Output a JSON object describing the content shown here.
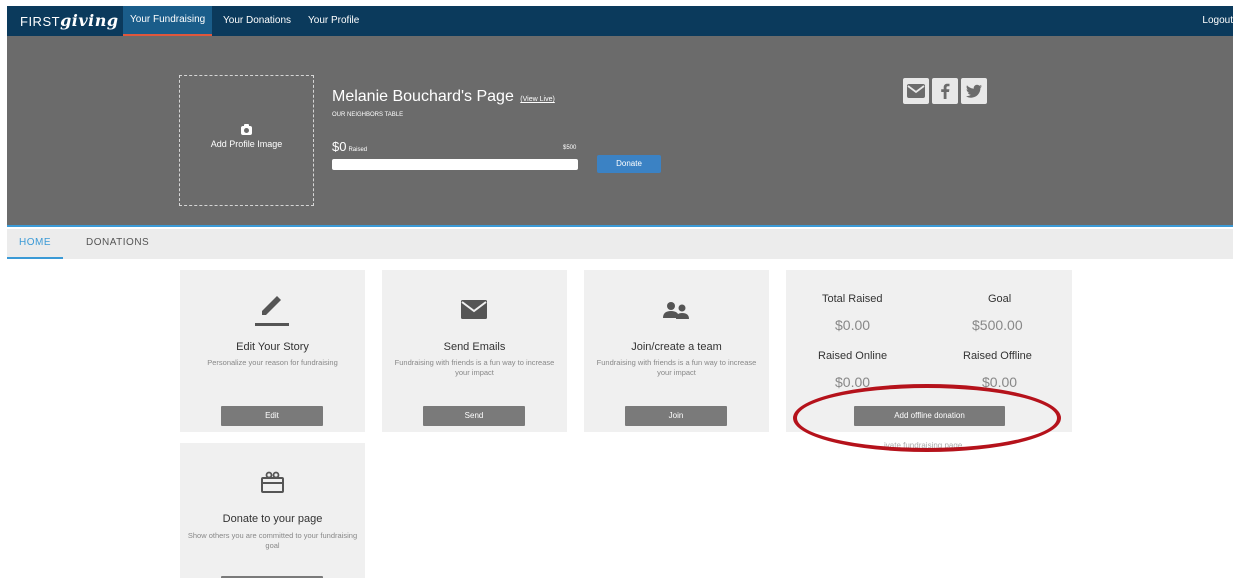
{
  "topnav": {
    "logo_prefix": "FIRST",
    "logo_suffix": "giving",
    "tabs": [
      {
        "label": "Your Fundraising",
        "active": true
      },
      {
        "label": "Your Donations",
        "active": false
      },
      {
        "label": "Your Profile",
        "active": false
      }
    ],
    "logout_label": "Logout"
  },
  "header": {
    "add_profile_image_label": "Add Profile Image",
    "page_title": "Melanie Bouchard's Page",
    "view_live_label": "(View Live)",
    "organization": "OUR NEIGHBORS TABLE",
    "raised_amount": "$0",
    "raised_label": "Raised",
    "goal_amount": "$500",
    "progress_fraction": 0,
    "donate_label": "Donate",
    "share_icons": [
      "email-icon",
      "facebook-icon",
      "twitter-icon"
    ]
  },
  "subnav": {
    "tabs": [
      {
        "label": "HOME",
        "active": true
      },
      {
        "label": "DONATIONS",
        "active": false
      }
    ]
  },
  "cards": {
    "story": {
      "icon": "pencil-icon",
      "title": "Edit Your Story",
      "description": "Personalize your reason for fundraising",
      "button": "Edit"
    },
    "emails": {
      "icon": "envelope-icon",
      "title": "Send Emails",
      "description": "Fundraising with friends is a fun way to increase your impact",
      "button": "Send"
    },
    "team": {
      "icon": "people-icon",
      "title": "Join/create a team",
      "description": "Fundraising with friends is a fun way to increase your impact",
      "button": "Join"
    },
    "donate": {
      "icon": "gift-icon",
      "title": "Donate to your page",
      "description": "Show others you are committed to your fundraising goal"
    }
  },
  "stats": {
    "total_raised_label": "Total Raised",
    "total_raised_value": "$0.00",
    "goal_label": "Goal",
    "goal_value": "$500.00",
    "raised_online_label": "Raised Online",
    "raised_online_value": "$0.00",
    "raised_offline_label": "Raised Offline",
    "raised_offline_value": "$0.00",
    "add_offline_label": "Add offline donation",
    "link_text": "…ivate fundraising page"
  },
  "colors": {
    "nav_bg": "#0b3a5c",
    "banner_bg": "#6b6b6b",
    "accent_blue": "#3b82c4",
    "highlight_red": "#b5121b"
  }
}
